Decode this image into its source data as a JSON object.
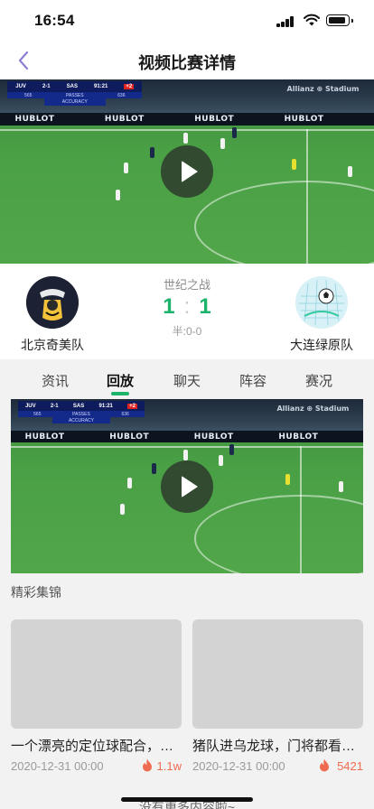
{
  "status_bar": {
    "time": "16:54"
  },
  "nav": {
    "title": "视频比赛详情",
    "back_icon": "chevron-left-icon"
  },
  "video": {
    "scorebug": {
      "home": "JUV",
      "score": "2-1",
      "away": "SAS",
      "clock": "91:21",
      "extra": "+2",
      "home_stat": "565",
      "stat_label": "PASSES",
      "away_stat": "636",
      "stat2": "ACCURACY"
    },
    "board_text": "HUBLOT",
    "stadium_text": "Allianz ⊕ Stadium",
    "play_icon": "play-icon"
  },
  "match": {
    "title": "世纪之战",
    "home_score": "1",
    "separator": ":",
    "away_score": "1",
    "half_score": "半:0-0",
    "home_team": "北京奇美队",
    "away_team": "大连绿原队"
  },
  "tabs": [
    {
      "label": "资讯",
      "active": false
    },
    {
      "label": "回放",
      "active": true
    },
    {
      "label": "聊天",
      "active": false
    },
    {
      "label": "阵容",
      "active": false
    },
    {
      "label": "赛况",
      "active": false
    }
  ],
  "highlights": {
    "section_title": "精彩集锦",
    "items": [
      {
        "title": "一个漂亮的定位球配合，打进一粒",
        "date": "2020-12-31 00:00",
        "count": "1.1w"
      },
      {
        "title": "猪队进乌龙球，门将都看傻了眼",
        "date": "2020-12-31 00:00",
        "count": "5421"
      }
    ]
  },
  "footer": {
    "text": "没有更多内容啦~"
  },
  "colors": {
    "accent": "#1db36b",
    "hot": "#ef6b4f",
    "back_arrow": "#8b7fd6"
  }
}
